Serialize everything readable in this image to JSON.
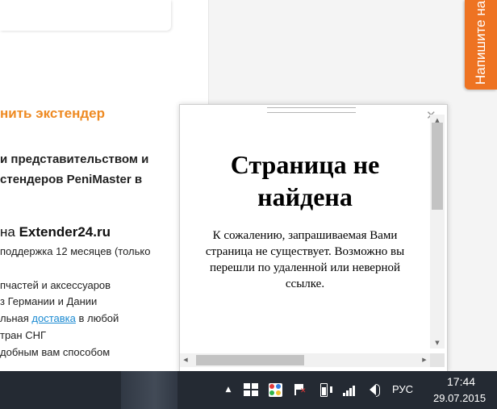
{
  "background_page": {
    "heading": "нить экстендер",
    "paragraph_bold_lines": [
      "и представительством и",
      "стендеров PeniMaster в"
    ],
    "shop_line_prefix": "на ",
    "shop_name": "Extender24.ru",
    "support_line": "поддержка 12 месяцев (только",
    "list_lines": [
      "пчастей и аксессуаров",
      "з Германии и Дании"
    ],
    "delivery_prefix": "льная ",
    "delivery_link": "доставка",
    "delivery_suffix": " в любой",
    "countries_line": "тран СНГ",
    "payment_line": "добным вам способом",
    "feedback_tab": "Напишите на"
  },
  "modal": {
    "title": "Страница не найдена",
    "message": "К сожалению, запрашиваемая Вами страница не существует. Возможно вы перешли по удаленной или неверной ссылке.",
    "close_icon": "close-icon"
  },
  "taskbar": {
    "language": "РУС",
    "time": "17:44",
    "date": "29.07.2015",
    "background_color": "#242a33"
  },
  "colors": {
    "accent_orange": "#ee8a22",
    "feedback_tab_orange": "#ee7322",
    "link_blue": "#1a8ad2"
  }
}
